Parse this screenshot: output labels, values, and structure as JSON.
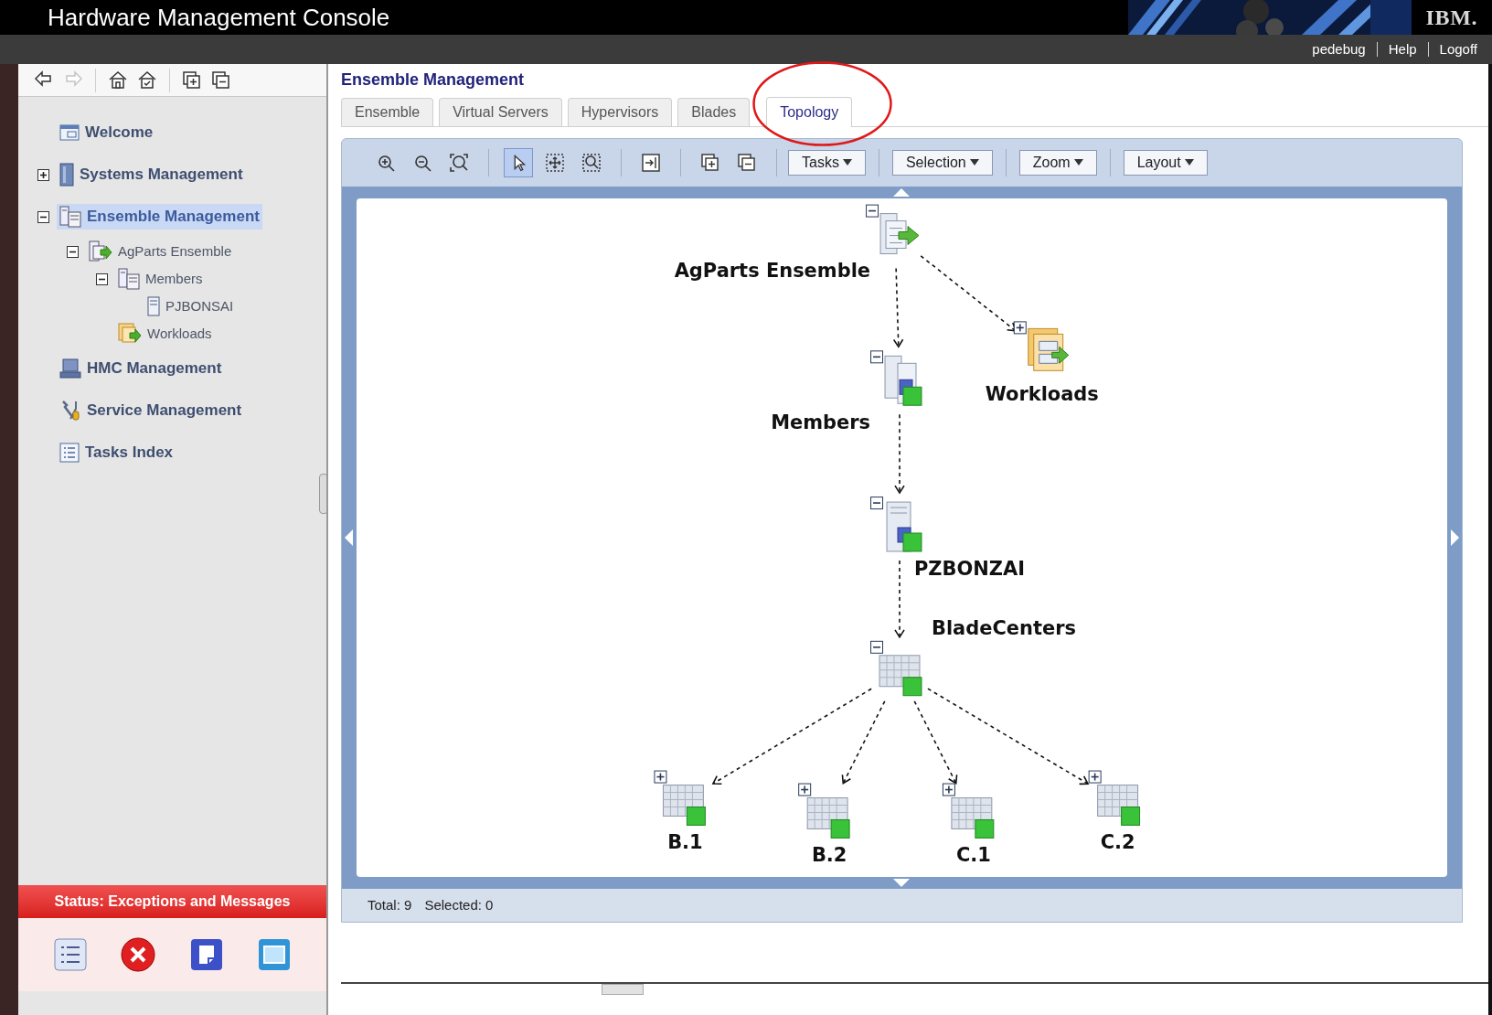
{
  "header": {
    "title": "Hardware Management Console",
    "logo": "IBM.",
    "links": [
      "pedebug",
      "Help",
      "Logoff"
    ]
  },
  "nav_toolbar": [
    {
      "disabled": false
    },
    {
      "disabled": true
    },
    {
      "disabled": false
    },
    {
      "disabled": false
    },
    {
      "disabled": false
    },
    {
      "disabled": false
    }
  ],
  "nav": {
    "items": [
      {
        "label": "Welcome",
        "kind": "window",
        "selected": false
      },
      {
        "label": "Systems Management",
        "kind": "tower",
        "selected": false,
        "expanded": false
      },
      {
        "label": "Ensemble Management",
        "kind": "ensemble",
        "selected": true,
        "expanded": true,
        "children": [
          {
            "label": "AgParts Ensemble",
            "kind": "group",
            "selected": false,
            "expanded": true,
            "children": [
              {
                "label": "Members",
                "kind": "members",
                "selected": false,
                "expanded": true,
                "children": [
                  {
                    "label": "PJBONSAI",
                    "kind": "server",
                    "selected": false
                  }
                ]
              },
              {
                "label": "Workloads",
                "kind": "workload",
                "selected": false
              }
            ]
          }
        ]
      },
      {
        "label": "HMC Management",
        "kind": "monitor",
        "selected": false
      },
      {
        "label": "Service Management",
        "kind": "tools",
        "selected": false
      },
      {
        "label": "Tasks Index",
        "kind": "list",
        "selected": false
      }
    ]
  },
  "status_panel": {
    "title": "Status: Exceptions and Messages"
  },
  "content": {
    "title": "Ensemble Management",
    "tabs": [
      {
        "label": "Ensemble",
        "selected": false
      },
      {
        "label": "Virtual Servers",
        "selected": false
      },
      {
        "label": "Hypervisors",
        "selected": false
      },
      {
        "label": "Blades",
        "selected": false
      },
      {
        "label": "Topology",
        "selected": true
      }
    ],
    "tools": [
      {
        "selected": false
      },
      {
        "selected": false
      },
      {
        "selected": false
      },
      {
        "selected": true
      },
      {
        "selected": false
      },
      {
        "selected": false
      },
      {
        "selected": false
      },
      {
        "selected": false
      },
      {
        "selected": false
      }
    ],
    "menus": [
      "Tasks",
      "Selection",
      "Zoom",
      "Layout"
    ],
    "topology": {
      "nodes": [
        {
          "label": "AgParts Ensemble",
          "kind": "ensemble",
          "expanded": true
        },
        {
          "label": "Members",
          "kind": "members",
          "expanded": true
        },
        {
          "label": "Workloads",
          "kind": "workload",
          "expanded": false
        },
        {
          "label": "PZBONZAI",
          "kind": "server",
          "expanded": true
        },
        {
          "label": "BladeCenters",
          "kind": "bladecenter",
          "expanded": true
        },
        {
          "label": "B.1",
          "kind": "blade",
          "expanded": false
        },
        {
          "label": "B.2",
          "kind": "blade",
          "expanded": false
        },
        {
          "label": "C.1",
          "kind": "blade",
          "expanded": false
        },
        {
          "label": "C.2",
          "kind": "blade",
          "expanded": false
        }
      ]
    },
    "status": {
      "total": "Total: 9",
      "selected": "Selected: 0"
    }
  }
}
